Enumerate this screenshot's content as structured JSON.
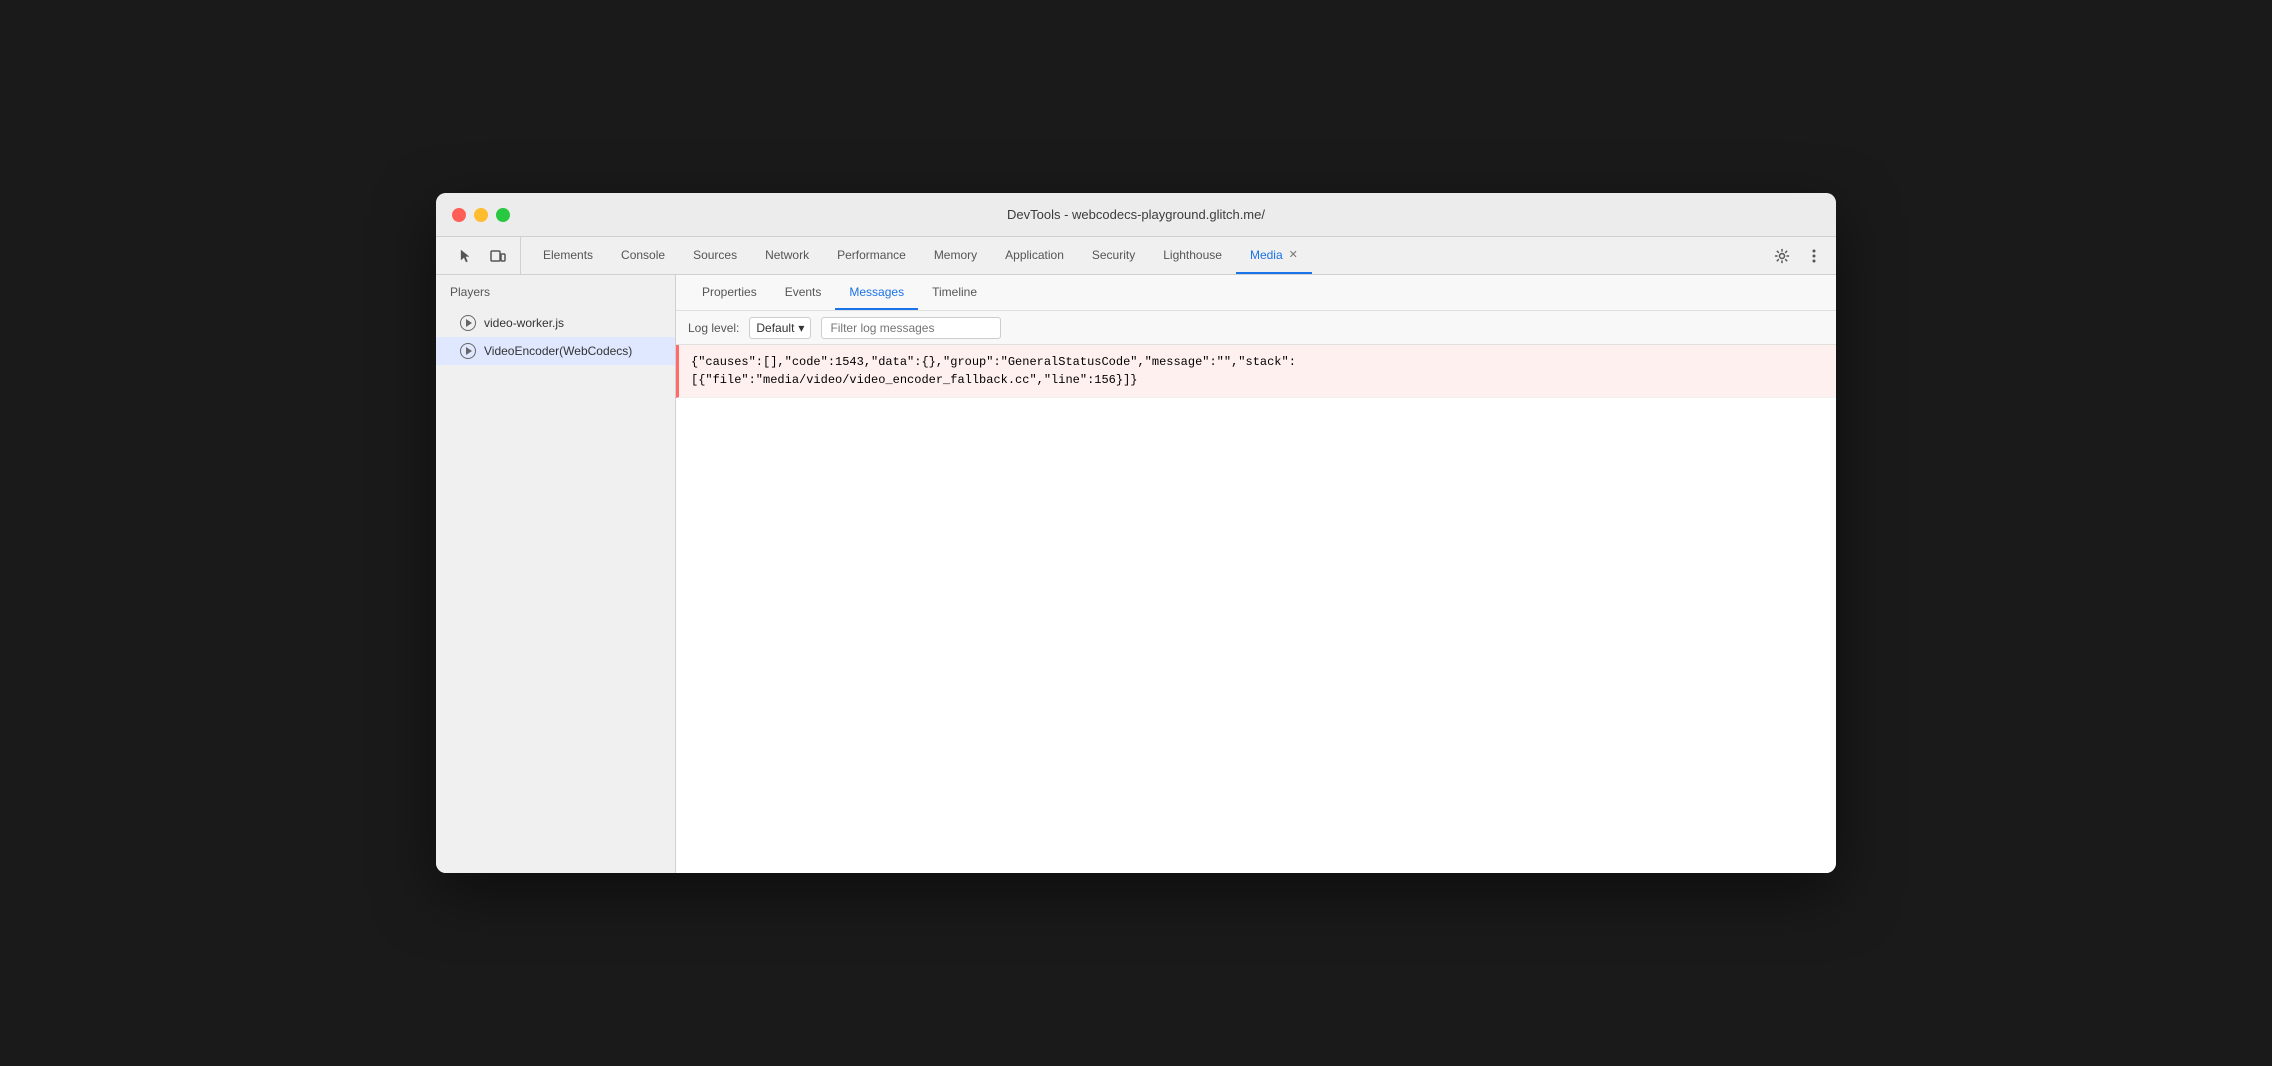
{
  "window": {
    "title": "DevTools - webcodecs-playground.glitch.me/"
  },
  "toolbar": {
    "cursor_icon": "⬡",
    "inspector_icon": "⬜",
    "settings_icon": "⚙",
    "more_icon": "⋮"
  },
  "tabs": [
    {
      "label": "Elements",
      "active": false
    },
    {
      "label": "Console",
      "active": false
    },
    {
      "label": "Sources",
      "active": false
    },
    {
      "label": "Network",
      "active": false
    },
    {
      "label": "Performance",
      "active": false
    },
    {
      "label": "Memory",
      "active": false
    },
    {
      "label": "Application",
      "active": false
    },
    {
      "label": "Security",
      "active": false
    },
    {
      "label": "Lighthouse",
      "active": false
    },
    {
      "label": "Media",
      "active": true
    }
  ],
  "sidebar": {
    "header": "Players",
    "players": [
      {
        "id": "video-worker",
        "label": "video-worker.js",
        "selected": false
      },
      {
        "id": "video-encoder",
        "label": "VideoEncoder(WebCodecs)",
        "selected": true
      }
    ]
  },
  "sub_tabs": [
    {
      "label": "Properties",
      "active": false
    },
    {
      "label": "Events",
      "active": false
    },
    {
      "label": "Messages",
      "active": true
    },
    {
      "label": "Timeline",
      "active": false
    }
  ],
  "log_controls": {
    "level_label": "Log level:",
    "level_value": "Default",
    "filter_placeholder": "Filter log messages"
  },
  "log_entries": [
    {
      "type": "error",
      "text": "{\"causes\":[],\"code\":1543,\"data\":{},\"group\":\"GeneralStatusCode\",\"message\":\"\",\"stack\":\n[{\"file\":\"media/video/video_encoder_fallback.cc\",\"line\":156}]}"
    }
  ]
}
